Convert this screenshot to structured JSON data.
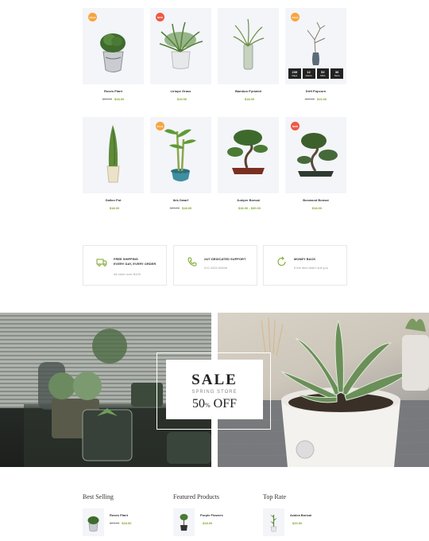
{
  "products": [
    {
      "name": "Roses Plant",
      "old_price": "$29.00",
      "price": "$18.00",
      "badge": "SALE",
      "badge_type": "sale",
      "icon": "succulent-tin-pot-icon"
    },
    {
      "name": "Liriope Grass",
      "old_price": "",
      "price": "$19.00",
      "badge": "NEW",
      "badge_type": "new",
      "icon": "grass-white-pot-icon"
    },
    {
      "name": "Bamboo Pyramid",
      "old_price": "",
      "price": "$18.00",
      "badge": "",
      "badge_type": "",
      "icon": "bamboo-glass-vase-icon"
    },
    {
      "name": "Drift Popcorn",
      "old_price": "$19.00",
      "price": "$16.00",
      "badge": "SALE",
      "badge_type": "sale",
      "icon": "drift-branch-vase-icon"
    },
    {
      "name": "Gallon Pot",
      "old_price": "",
      "price": "$18.00",
      "badge": "",
      "badge_type": "",
      "icon": "cypress-pot-icon"
    },
    {
      "name": "Ibis Dwarf",
      "old_price": "$20.00",
      "price": "$18.00",
      "badge": "SALE",
      "badge_type": "sale",
      "icon": "lucky-bamboo-pot-icon"
    },
    {
      "name": "Juniper Bonsai",
      "old_price": "",
      "price": "$18.00 - $30.00",
      "badge": "",
      "badge_type": "",
      "icon": "juniper-bonsai-icon"
    },
    {
      "name": "Boxwood Bonsai",
      "old_price": "",
      "price": "$18.00",
      "badge": "NEW",
      "badge_type": "new",
      "icon": "boxwood-bonsai-icon"
    }
  ],
  "countdown": [
    {
      "value": "239",
      "unit": "Days"
    },
    {
      "value": "12",
      "unit": "Hours"
    },
    {
      "value": "52",
      "unit": "Mins"
    },
    {
      "value": "36",
      "unit": "Secs"
    }
  ],
  "features": [
    {
      "title": "FREE SHIPPING",
      "title2": "EVERY DAY, EVERY ORDER",
      "sub": "All order over $100",
      "icon": "truck-icon"
    },
    {
      "title": "24/7 DEDICATED SUPPORT",
      "title2": "",
      "sub": "012 4434 54466",
      "icon": "phone-icon"
    },
    {
      "title": "MONEY BACK",
      "title2": "",
      "sub": "If the item didn't suit you",
      "icon": "refresh-icon"
    }
  ],
  "banner": {
    "sale": "SALE",
    "store": "SPRING STORE",
    "percent": "50",
    "pct_sign": "%",
    "off": "OFF"
  },
  "lists": [
    {
      "heading": "Best Selling",
      "item": {
        "name": "Roses Plant",
        "old_price": "$29.00",
        "price": "$18.00"
      }
    },
    {
      "heading": "Featured Products",
      "item": {
        "name": "Purple Flowers",
        "old_price": "",
        "price": "$18.00"
      }
    },
    {
      "heading": "Top Rate",
      "item": {
        "name": "Azalea Bonsai",
        "old_price": "",
        "price": "$20.00"
      }
    }
  ],
  "colors": {
    "accent": "#7aa52b",
    "badge_sale": "#f7a440",
    "badge_new": "#ee5a45"
  }
}
